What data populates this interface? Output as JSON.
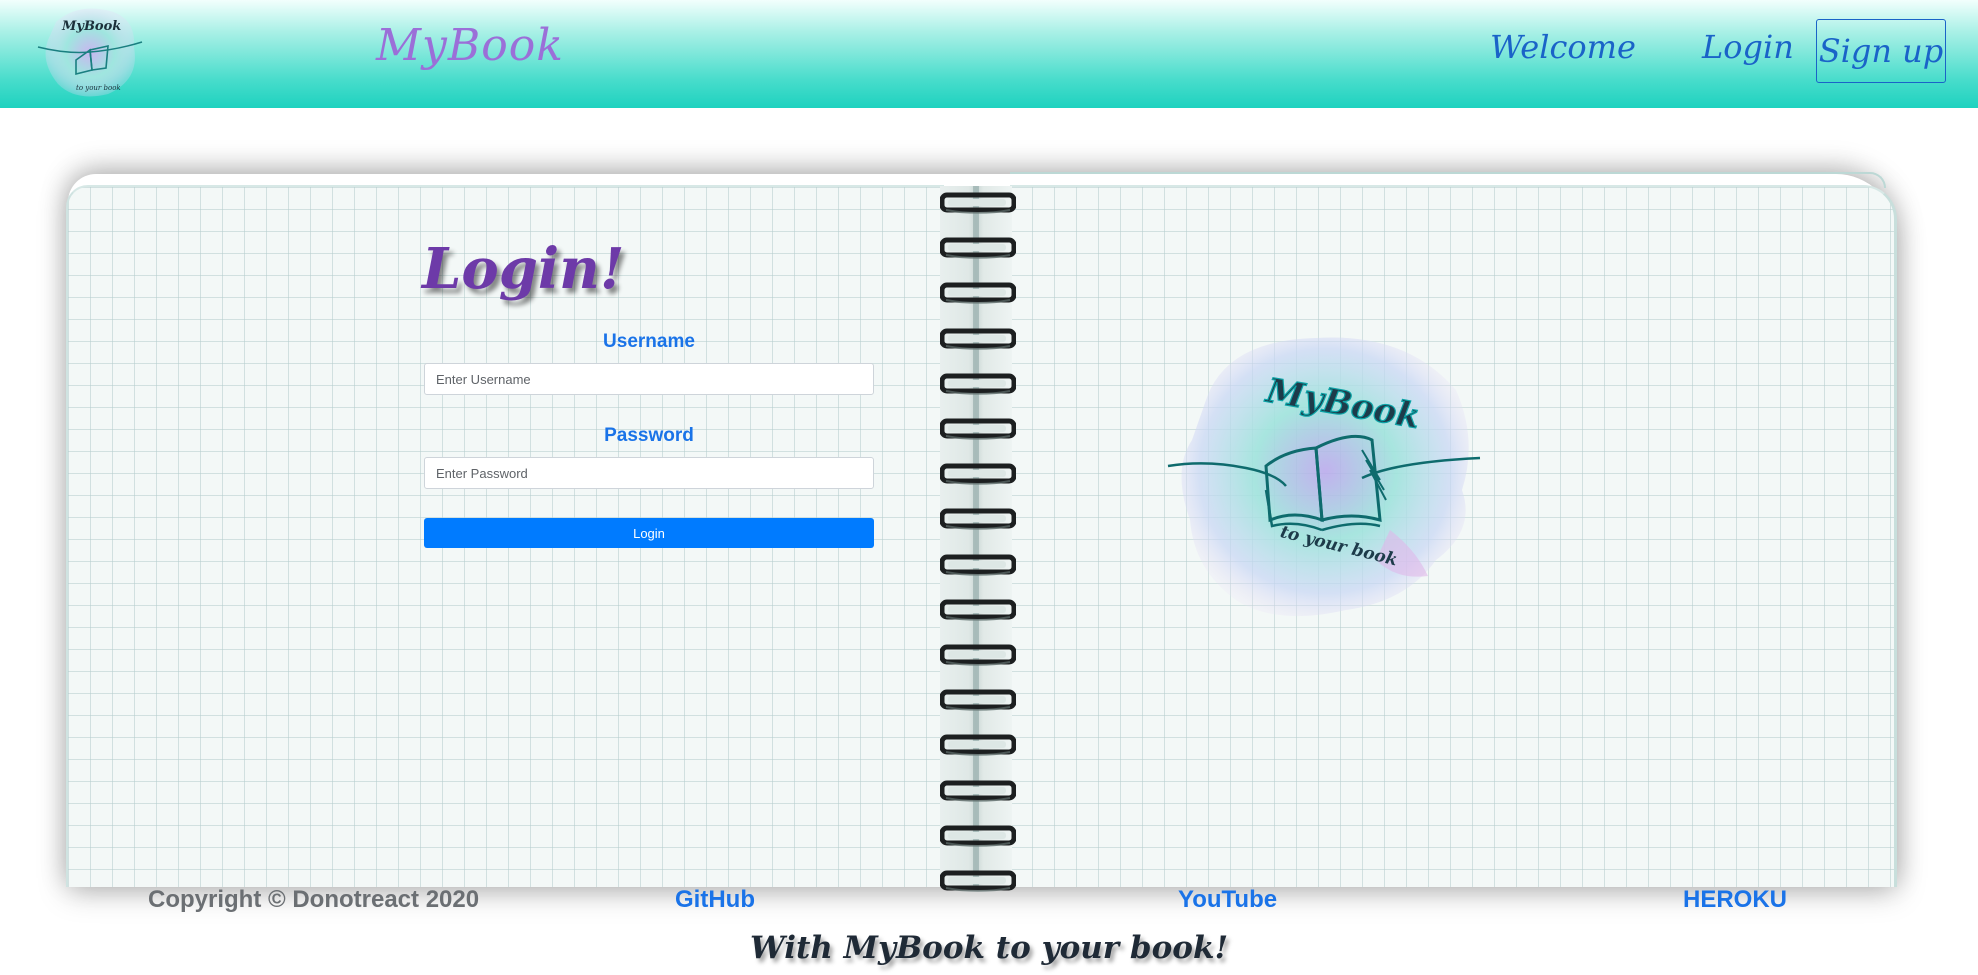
{
  "navbar": {
    "brand": "MyBook",
    "links": {
      "welcome": "Welcome",
      "login": "Login",
      "signup": "Sign up"
    },
    "logo_text": "MyBook",
    "logo_subtext": "to your book"
  },
  "login": {
    "title": "Login!",
    "username_label": "Username",
    "username_placeholder": "Enter Username",
    "password_label": "Password",
    "password_placeholder": "Enter Password",
    "submit_label": "Login"
  },
  "illustration": {
    "logo_text": "MyBook",
    "logo_subtext": "to your book"
  },
  "footer": {
    "copyright": "Copyright © Donotreact 2020",
    "github": "GitHub",
    "youtube": "YouTube",
    "heroku": "HEROKU",
    "tagline": "With MyBook to your book!"
  },
  "colors": {
    "header_gradient_top": "#f2fffd",
    "header_gradient_bottom": "#1ed2bf",
    "brand": "#9b6fd8",
    "nav_link": "#1a63c8",
    "primary_button": "#007bff",
    "label_blue": "#1a73e8",
    "title_purple": "#6d3aa8"
  }
}
